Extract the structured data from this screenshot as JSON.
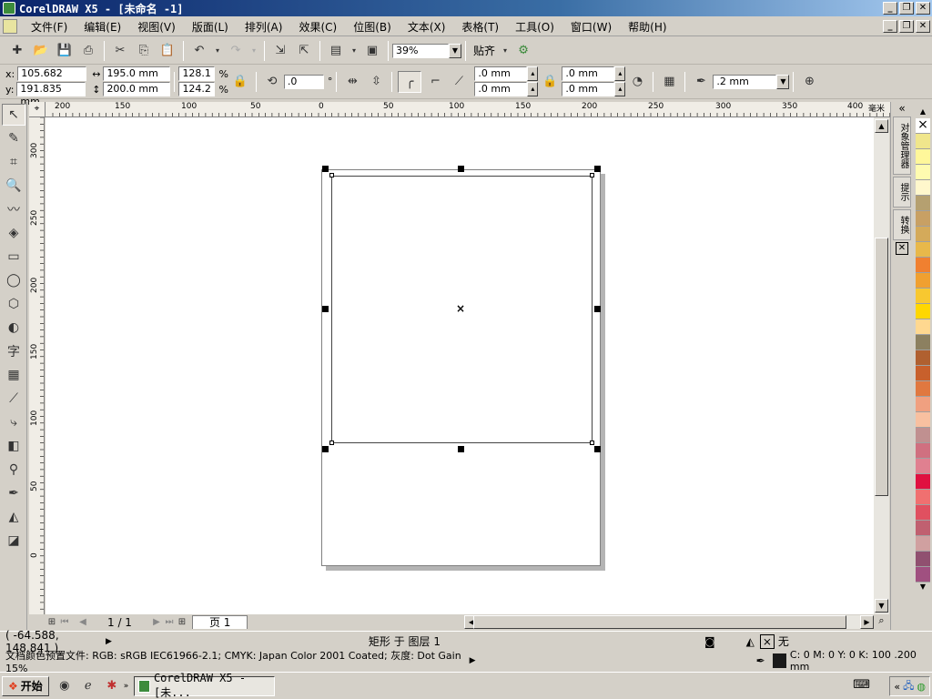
{
  "window": {
    "title": "CorelDRAW X5 - [未命名 -1]",
    "min_glyph": "_",
    "max_glyph": "❐",
    "close_glyph": "✕"
  },
  "menu": {
    "items": [
      "文件(F)",
      "编辑(E)",
      "视图(V)",
      "版面(L)",
      "排列(A)",
      "效果(C)",
      "位图(B)",
      "文本(X)",
      "表格(T)",
      "工具(O)",
      "窗口(W)",
      "帮助(H)"
    ]
  },
  "toolbar": {
    "zoom_value": "39%",
    "snap_label": "贴齐"
  },
  "property_bar": {
    "x_label": "x:",
    "y_label": "y:",
    "x_value": "105.682 mm",
    "y_value": "191.835 mm",
    "width_value": "195.0 mm",
    "height_value": "200.0 mm",
    "scale_x": "128.1",
    "scale_y": "124.2",
    "percent": "%",
    "angle_value": ".0",
    "degree": "°",
    "corner_tl": ".0 mm",
    "corner_bl": ".0 mm",
    "corner_tr": ".0 mm",
    "corner_br": ".0 mm",
    "outline_width": ".2 mm"
  },
  "ruler": {
    "h_labels": [
      "200",
      "150",
      "100",
      "50",
      "0",
      "50",
      "100",
      "150",
      "200",
      "250",
      "300",
      "350",
      "400"
    ],
    "h_unit": "毫米",
    "v_labels": [
      "300",
      "250",
      "200",
      "150",
      "100",
      "50",
      "0"
    ]
  },
  "page_nav": {
    "counter": "1 / 1",
    "tab_label": "页 1"
  },
  "dockers": {
    "object_manager": "对象管理器",
    "hints": "提示",
    "transform": "转换"
  },
  "palette": {
    "colors": [
      "#f0e68c",
      "#fff79a",
      "#fffbb0",
      "#fff7cc",
      "#b5a070",
      "#c8a064",
      "#d4aa5a",
      "#e8b84a",
      "#f08030",
      "#f0a030",
      "#f8c830",
      "#ffd700",
      "#ffd890",
      "#8c8060",
      "#b06030",
      "#c8602c",
      "#e07840",
      "#f0a080",
      "#f8c0a0",
      "#c09090",
      "#d07080",
      "#e08090",
      "#e01040",
      "#f07070",
      "#e05060",
      "#c06070",
      "#d0a0a0",
      "#905070",
      "#a05080"
    ]
  },
  "status": {
    "coords": "( -64.588, 148.841 )",
    "object_info": "矩形 于 图层 1",
    "fill_label": "无",
    "color_profile": "文档颜色预置文件: RGB: sRGB IEC61966-2.1; CMYK: Japan Color 2001 Coated; 灰度: Dot Gain 15%",
    "outline_info": "C: 0 M: 0 Y: 0 K: 100  .200 mm"
  },
  "taskbar": {
    "start_label": "开始",
    "task_label": "CorelDRAW X5 - [未..."
  }
}
